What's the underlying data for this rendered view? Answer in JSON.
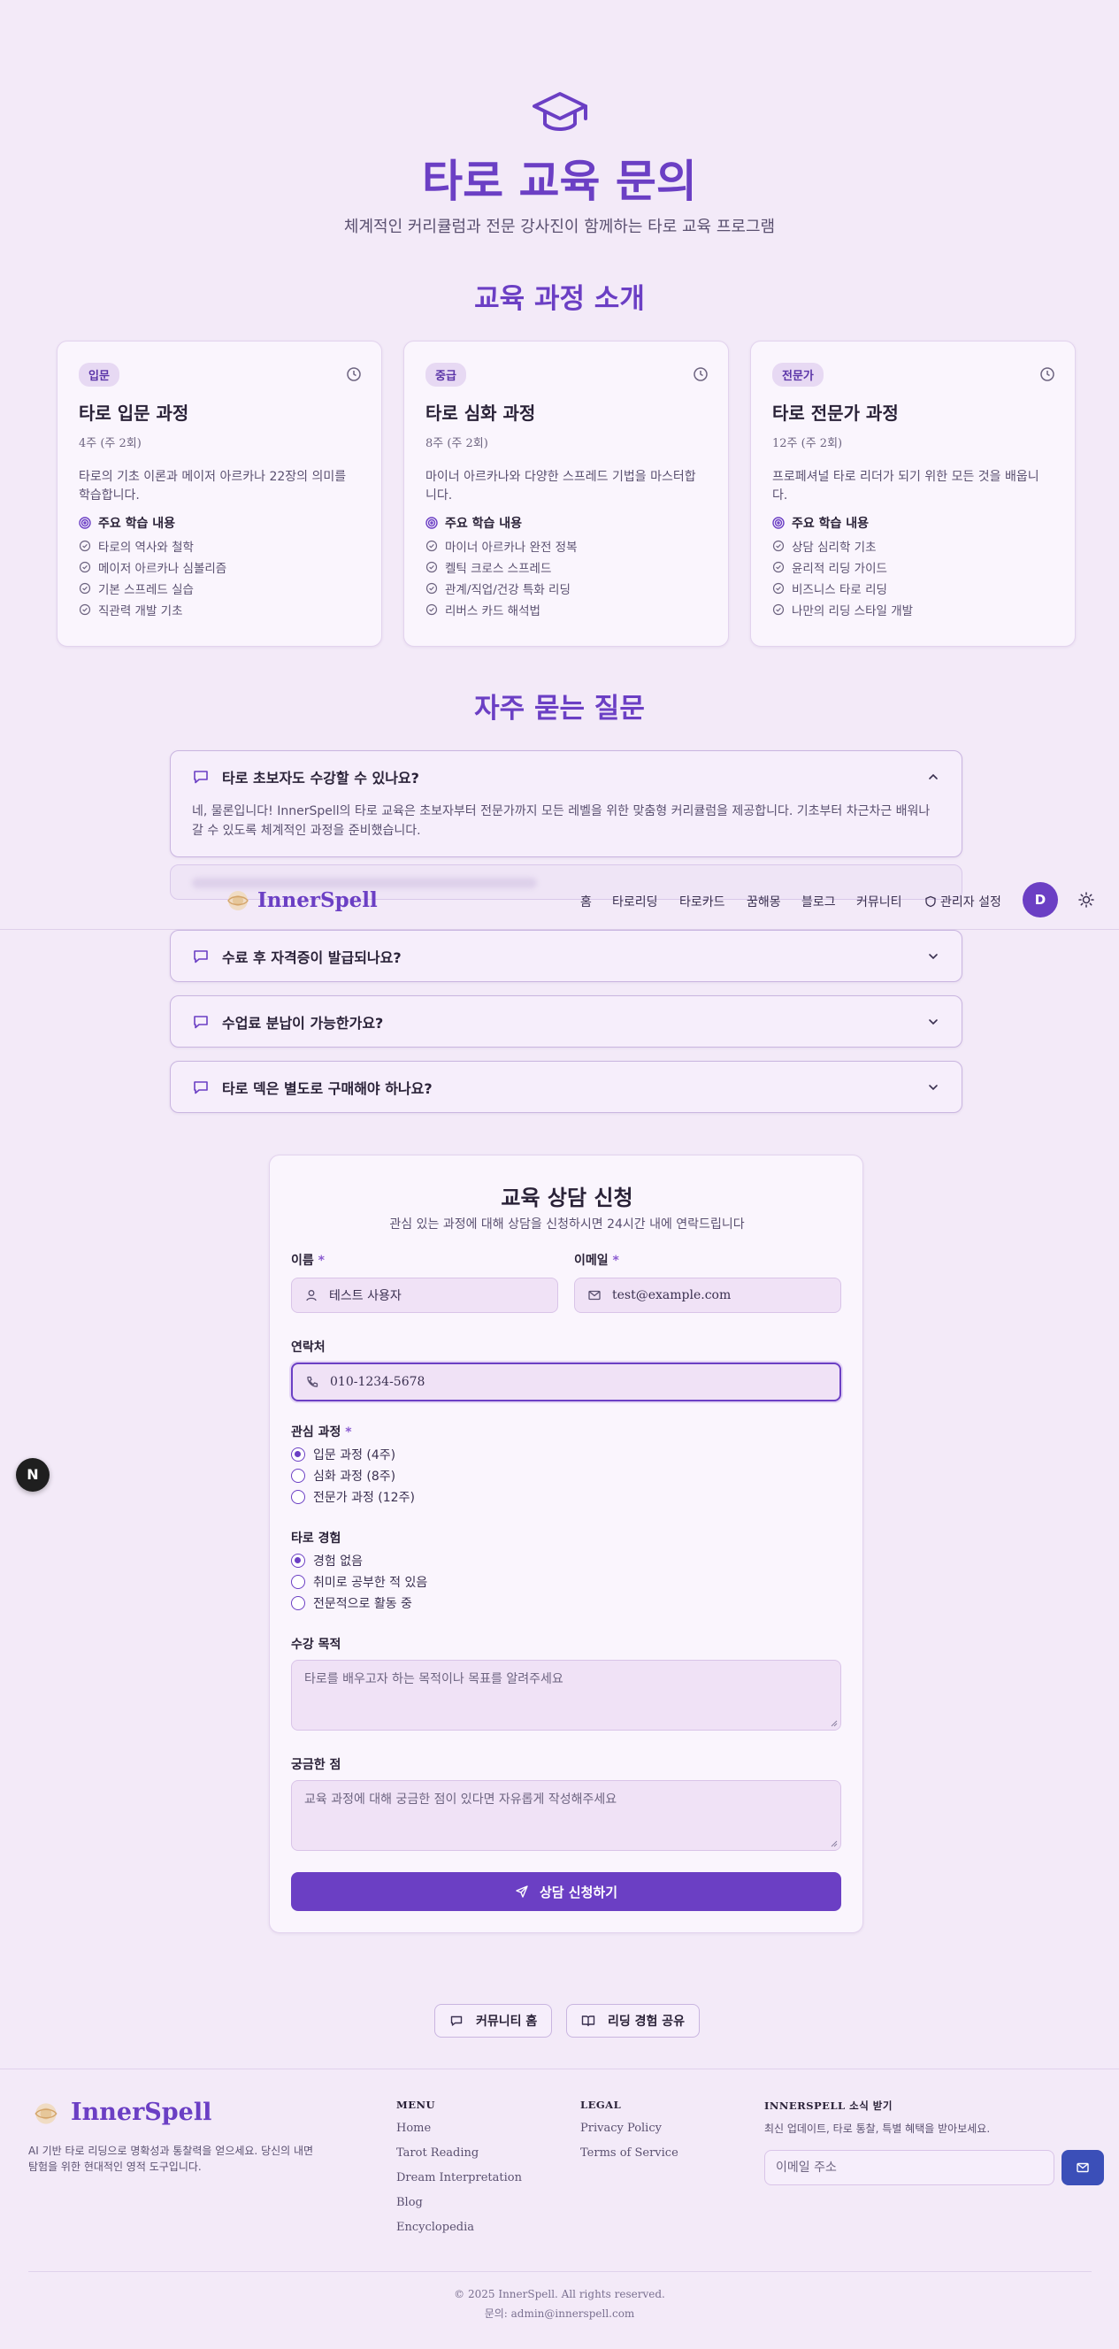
{
  "hero": {
    "title": "타로 교육 문의",
    "subtitle": "체계적인 커리큘럼과 전문 강사진이 함께하는 타로 교육 프로그램"
  },
  "courses_section": {
    "title": "교육 과정 소개",
    "learn_heading": "주요 학습 내용",
    "cards": [
      {
        "badge": "입문",
        "title": "타로 입문 과정",
        "duration": "4주 (주 2회)",
        "description": "타로의 기초 이론과 메이저 아르카나 22장의 의미를 학습합니다.",
        "items": [
          "타로의 역사와 철학",
          "메이저 아르카나 심볼리즘",
          "기본 스프레드 실습",
          "직관력 개발 기초"
        ]
      },
      {
        "badge": "중급",
        "title": "타로 심화 과정",
        "duration": "8주 (주 2회)",
        "description": "마이너 아르카나와 다양한 스프레드 기법을 마스터합니다.",
        "items": [
          "마이너 아르카나 완전 정복",
          "켈틱 크로스 스프레드",
          "관계/직업/건강 특화 리딩",
          "리버스 카드 해석법"
        ]
      },
      {
        "badge": "전문가",
        "title": "타로 전문가 과정",
        "duration": "12주 (주 2회)",
        "description": "프로페셔널 타로 리더가 되기 위한 모든 것을 배웁니다.",
        "items": [
          "상담 심리학 기초",
          "윤리적 리딩 가이드",
          "비즈니스 타로 리딩",
          "나만의 리딩 스타일 개발"
        ]
      }
    ]
  },
  "faq_section": {
    "title": "자주 묻는 질문",
    "items": [
      {
        "question": "타로 초보자도 수강할 수 있나요?",
        "answer": "네, 물론입니다! InnerSpell의 타로 교육은 초보자부터 전문가까지 모든 레벨을 위한 맞춤형 커리큘럼을 제공합니다. 기초부터 차근차근 배워나갈 수 있도록 체계적인 과정을 준비했습니다.",
        "expanded": true
      },
      {
        "question": "수료 후 자격증이 발급되나요?",
        "expanded": false
      },
      {
        "question": "수업료 분납이 가능한가요?",
        "expanded": false
      },
      {
        "question": "타로 덱은 별도로 구매해야 하나요?",
        "expanded": false
      }
    ]
  },
  "navbar": {
    "brand": "InnerSpell",
    "items": [
      "홈",
      "타로리딩",
      "타로카드",
      "꿈해몽",
      "블로그",
      "커뮤니티"
    ],
    "admin": "관리자 설정",
    "avatar": "D"
  },
  "form": {
    "title": "교육 상담 신청",
    "subtitle": "관심 있는 과정에 대해 상담을 신청하시면 24시간 내에 연락드립니다",
    "name_label": "이름",
    "name_value": "테스트 사용자",
    "email_label": "이메일",
    "email_value": "test@example.com",
    "phone_label": "연락처",
    "phone_value": "010-1234-5678",
    "required_mark": "*",
    "course_label": "관심 과정",
    "course_options": [
      "입문 과정 (4주)",
      "심화 과정 (8주)",
      "전문가 과정 (12주)"
    ],
    "course_selected": 0,
    "experience_label": "타로 경험",
    "experience_options": [
      "경험 없음",
      "취미로 공부한 적 있음",
      "전문적으로 활동 중"
    ],
    "experience_selected": 0,
    "purpose_label": "수강 목적",
    "purpose_placeholder": "타로를 배우고자 하는 목적이나 목표를 알려주세요",
    "question_label": "궁금한 점",
    "question_placeholder": "교육 과정에 대해 궁금한 점이 있다면 자유롭게 작성해주세요",
    "submit": "상담 신청하기"
  },
  "floating_button": "N",
  "bottom_buttons": {
    "community": "커뮤니티 홈",
    "share": "리딩 경험 공유"
  },
  "footer": {
    "brand": "InnerSpell",
    "description": "AI 기반 타로 리딩으로 명확성과 통찰력을 얻으세요. 당신의 내면 탐험을 위한 현대적인 영적 도구입니다.",
    "menu_heading": "MENU",
    "menu_links": [
      "Home",
      "Tarot Reading",
      "Dream Interpretation",
      "Blog",
      "Encyclopedia"
    ],
    "legal_heading": "LEGAL",
    "legal_links": [
      "Privacy Policy",
      "Terms of Service"
    ],
    "newsletter_heading": "INNERSPELL 소식 받기",
    "newsletter_desc": "최신 업데이트, 타로 통찰, 특별 혜택을 받아보세요.",
    "newsletter_placeholder": "이메일 주소",
    "copyright": "© 2025 InnerSpell. All rights reserved.",
    "contact": "문의: admin@innerspell.com"
  },
  "colors": {
    "accent": "#6b3fc4",
    "background": "#f3eaf8",
    "card": "#faf5fd",
    "send_button": "#3b4fb8"
  }
}
